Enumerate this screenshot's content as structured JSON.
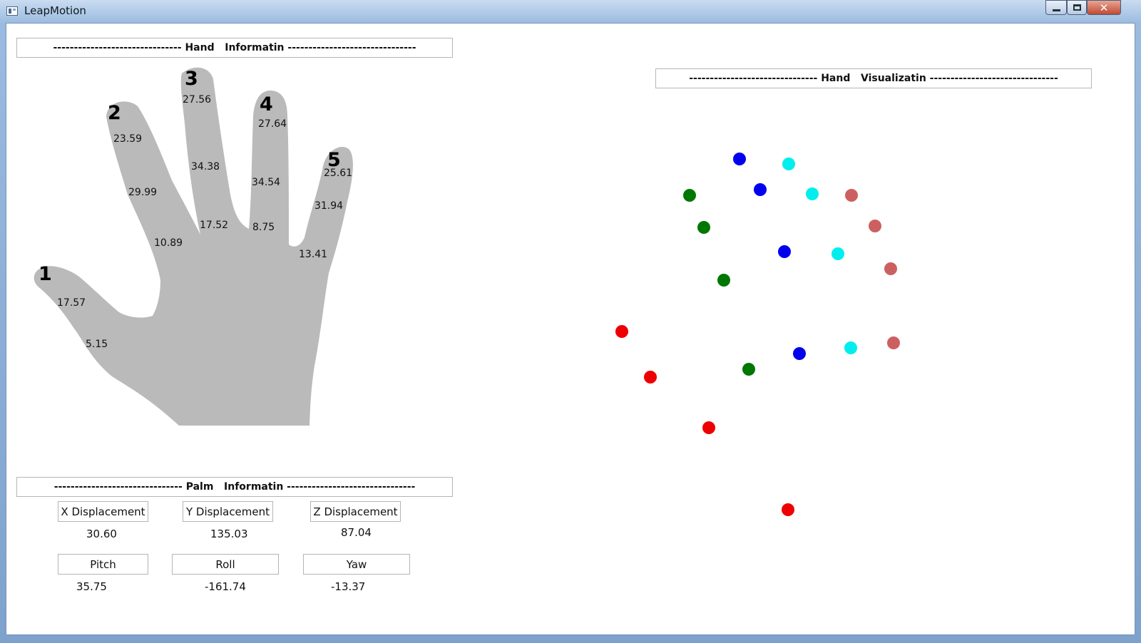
{
  "window": {
    "title": "LeapMotion",
    "controls": {
      "minimize": "minimize-icon",
      "maximize": "maximize-icon",
      "close": "✕"
    }
  },
  "hand_info": {
    "header": "------------------------------- Hand   Informatin -------------------------------",
    "fingers": [
      {
        "number": "1",
        "bones": [
          "17.57",
          "5.15"
        ]
      },
      {
        "number": "2",
        "bones": [
          "23.59",
          "29.99",
          "10.89"
        ]
      },
      {
        "number": "3",
        "bones": [
          "27.56",
          "34.38",
          "17.52"
        ]
      },
      {
        "number": "4",
        "bones": [
          "27.64",
          "34.54",
          "8.75"
        ]
      },
      {
        "number": "5",
        "bones": [
          "25.61",
          "31.94",
          "13.41"
        ]
      }
    ]
  },
  "palm_info": {
    "header": "------------------------------- Palm   Informatin -------------------------------",
    "fields": [
      {
        "label": "X Displacement",
        "value": "30.60"
      },
      {
        "label": "Y Displacement",
        "value": "135.03"
      },
      {
        "label": "Z Displacement",
        "value": "87.04"
      },
      {
        "label": "Pitch",
        "value": "35.75"
      },
      {
        "label": "Roll",
        "value": "-161.74"
      },
      {
        "label": "Yaw",
        "value": "-13.37"
      }
    ]
  },
  "hand_visualization": {
    "header": "------------------------------- Hand   Visualizatin -------------------------------",
    "joint_colors": {
      "thumb": "#ee0000",
      "index": "#007700",
      "middle": "#0000ee",
      "ring": "#00eeee",
      "pinky": "#cc6060"
    }
  },
  "colors": {
    "hand_silhouette": "#bababa",
    "border": "#b5b5b5"
  }
}
